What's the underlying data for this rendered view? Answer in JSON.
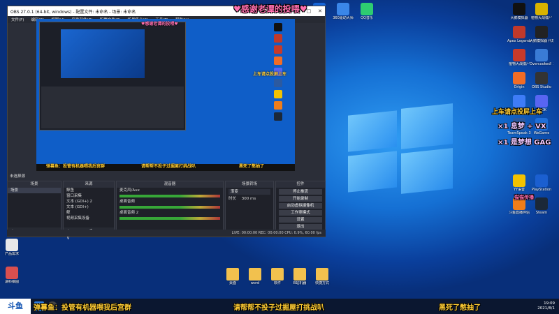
{
  "overlays": {
    "thanks": "♥感谢老谭的投喂♥",
    "bottom_left": "弹幕鱼：投管有机器喂我后宫群",
    "bottom_center": "请帮帮不投子过掘屋打挑战叭",
    "bottom_right": "黑死了憋抽了",
    "right_line1": "上车请点投屏上车",
    "right_line2": "×1 息梦 + VX",
    "right_line3": "×1 是梦想 GAG",
    "right_line4": "猫猫传播"
  },
  "obs": {
    "title": "OBS 27.0.1 (64-bit, windows) - 配置文件: 未命名 - 场景: 未命名",
    "menu": [
      "文件(F)",
      "编辑(E)",
      "视图(V)",
      "停靠部件(D)",
      "配置文件(P)",
      "场景集合(S)",
      "工具(T)",
      "帮助(H)"
    ],
    "dock_header": "未选择源",
    "scenes": {
      "title": "场景",
      "items": [
        "场景"
      ]
    },
    "sources": {
      "title": "来源",
      "items": [
        "鲸鱼",
        "窗口采集",
        "文本 (GDI+) 2",
        "文本 (GDI+)",
        "鲸",
        "视频采集设备"
      ]
    },
    "mixer": {
      "title": "混音器",
      "tracks": [
        "麦克风/Aux",
        "桌面音频",
        "桌面音频 2"
      ]
    },
    "transitions": {
      "title": "场景转场",
      "type": "渐变",
      "duration_label": "时长",
      "duration": "300 ms"
    },
    "controls": {
      "title": "控件",
      "buttons": [
        "停止推流",
        "开始录制",
        "启动虚拟摄像机",
        "工作室模式",
        "设置",
        "退出"
      ]
    },
    "status": "LIVE: 00:00:00   REC: 00:00:00   CPU: 0.9%, 60.00 fps"
  },
  "desktop_right": [
    {
      "label": "大鹅模拟器",
      "icon": "black-game-icon",
      "color": "#111111"
    },
    {
      "label": "植物大战僵尸",
      "icon": "lightning-icon",
      "color": "#d9b300"
    },
    {
      "label": "Apex Legends",
      "icon": "apex-icon",
      "color": "#c0392b"
    },
    {
      "label": "大鹅模拟器 代理者",
      "icon": "mw-icon",
      "color": "#222222"
    },
    {
      "label": "植物大战僵尸",
      "icon": "pvz-icon",
      "color": "#c73a2a"
    },
    {
      "label": "Overcooked! 2",
      "icon": "overcooked-icon",
      "color": "#3a7bd5"
    },
    {
      "label": "Origin",
      "icon": "origin-icon",
      "color": "#f26c25"
    },
    {
      "label": "OBS Studio",
      "icon": "obs-icon",
      "color": "#333333"
    },
    {
      "label": "开黑啦",
      "icon": "kaiheila-icon",
      "color": "#3e7cf7"
    },
    {
      "label": "KOOK",
      "icon": "discord-icon",
      "color": "#5865f2"
    },
    {
      "label": "TeamSpeak 3",
      "icon": "teamspeak-icon",
      "color": "#2c5aa0"
    },
    {
      "label": "WeGame",
      "icon": "wegame-icon",
      "color": "#1f6fd9"
    },
    {
      "label": "YY语音",
      "icon": "yy-icon",
      "color": "#f2c200"
    },
    {
      "label": "PlayStation",
      "icon": "playstation-icon",
      "color": "#1b5fd0"
    },
    {
      "label": "斗鱼直播伴侣",
      "icon": "douyu-icon",
      "color": "#ef7d1a"
    },
    {
      "label": "Steam",
      "icon": "steam-icon",
      "color": "#1b2838"
    }
  ],
  "desktop_top": [
    {
      "label": "斗鱼",
      "icon": "douyu-blue-icon",
      "color": "#1565d8"
    },
    {
      "label": "360驱动大师",
      "icon": "driver-icon",
      "color": "#3a86e8"
    },
    {
      "label": "QQ音乐",
      "icon": "qqmusic-icon",
      "color": "#2ecc71"
    }
  ],
  "desktop_left": [
    {
      "label": "产品需求",
      "icon": "doc-icon",
      "color": "#e8e8e8"
    },
    {
      "label": "湖科稿图",
      "icon": "image-icon",
      "color": "#d94f4f"
    }
  ],
  "desktop_folders": [
    {
      "label": "桌面"
    },
    {
      "label": "word"
    },
    {
      "label": "软件"
    },
    {
      "label": "B站机器"
    },
    {
      "label": "快捷方式"
    }
  ],
  "taskbar": {
    "logo": "斗鱼",
    "time": "19:09",
    "date": "2021/8/1"
  }
}
